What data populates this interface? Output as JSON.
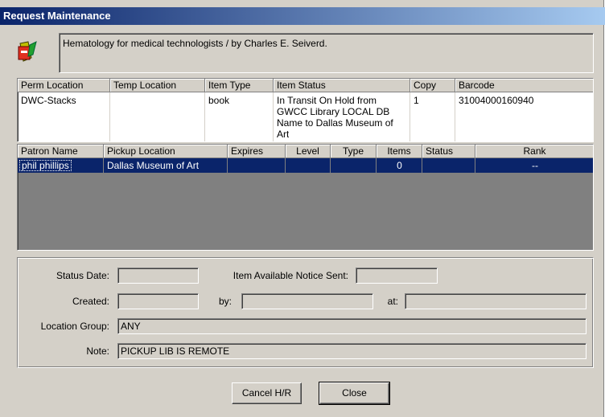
{
  "window": {
    "title": "Request Maintenance"
  },
  "icons": {
    "app": "book-with-red-clip-icon"
  },
  "item": {
    "title": "Hematology for medical technologists / by Charles E. Seiverd."
  },
  "copies_table": {
    "headers": [
      "Perm Location",
      "Temp Location",
      "Item Type",
      "Item Status",
      "Copy",
      "Barcode"
    ],
    "row": {
      "perm_location": "DWC-Stacks",
      "temp_location": "",
      "item_type": "book",
      "item_status_lines": [
        "In Transit On Hold from",
        "GWCC Library LOCAL DB",
        "Name to Dallas Museum of",
        "Art"
      ],
      "copy": "1",
      "barcode": "31004000160940"
    }
  },
  "holds_table": {
    "headers": [
      "Patron Name",
      "Pickup Location",
      "Expires",
      "Level",
      "Type",
      "Items",
      "Status",
      "Rank"
    ],
    "row": {
      "patron_name": "phil phillips",
      "pickup_location": "Dallas Museum of Art",
      "expires": "",
      "level": "",
      "type": "",
      "items": "0",
      "status": "",
      "rank": "--"
    },
    "colors": {
      "selected_bg": "#0a246a",
      "selected_fg": "#ffffff",
      "empty_bg": "#808080"
    }
  },
  "details": {
    "status_date_label": "Status Date:",
    "status_date_value": "",
    "notice_sent_label": "Item Available Notice Sent:",
    "notice_sent_value": "",
    "created_label": "Created:",
    "created_value": "",
    "by_label": "by:",
    "by_value": "",
    "at_label": "at:",
    "at_value": "",
    "location_group_label": "Location Group:",
    "location_group_value": "ANY",
    "note_label": "Note:",
    "note_value": "PICKUP LIB IS REMOTE"
  },
  "buttons": {
    "cancel_hr": "Cancel H/R",
    "close": "Close"
  },
  "colors": {
    "title_start": "#0a246a",
    "title_end": "#a6caf0",
    "face": "#d4d0c8"
  }
}
